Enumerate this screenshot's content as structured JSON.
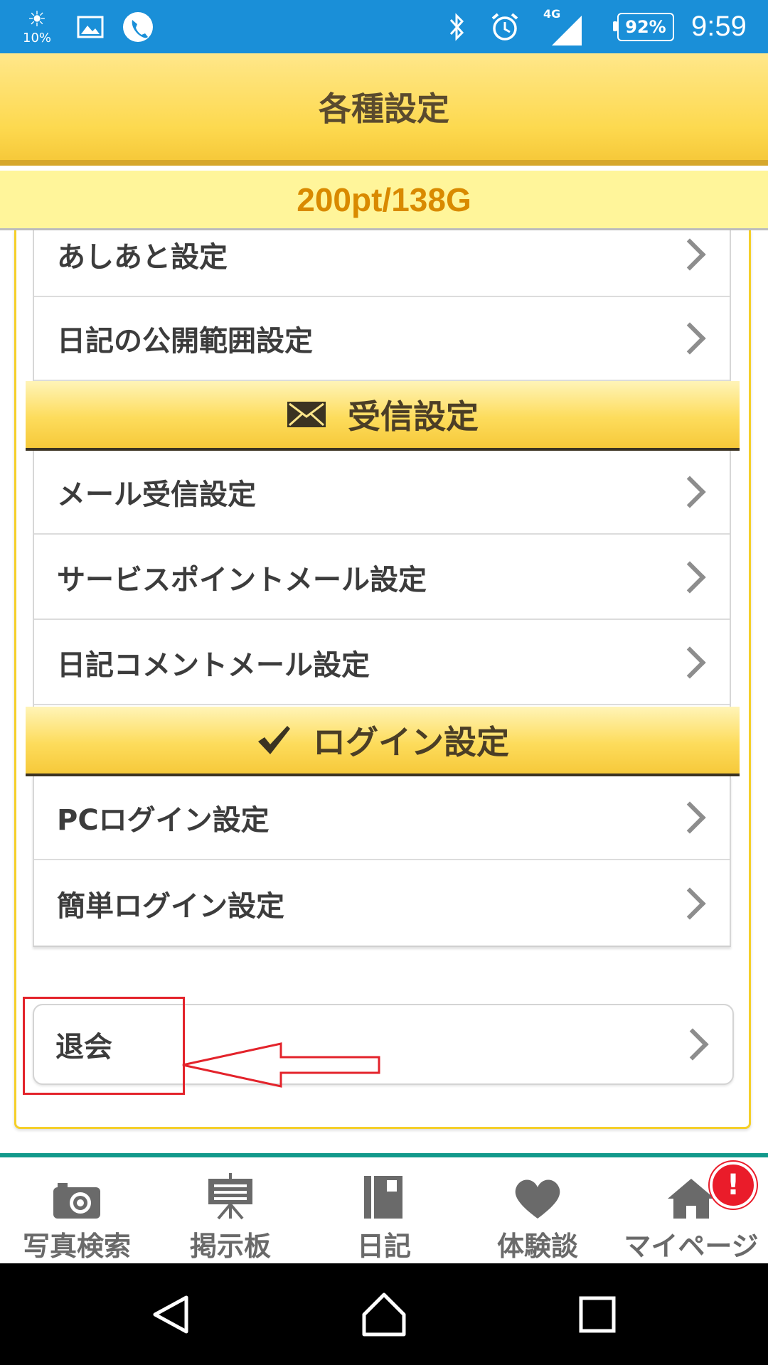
{
  "status_bar": {
    "brightness_percent": "10%",
    "network": "4G",
    "battery": "92%",
    "time": "9:59"
  },
  "header": {
    "title": "各種設定"
  },
  "points": {
    "text": "200pt/138G"
  },
  "top_items": [
    {
      "label": "あしあと設定"
    },
    {
      "label": "日記の公開範囲設定"
    }
  ],
  "sections": [
    {
      "title": "受信設定",
      "icon": "envelope-icon",
      "items": [
        {
          "label": "メール受信設定"
        },
        {
          "label": "サービスポイントメール設定"
        },
        {
          "label": "日記コメントメール設定"
        }
      ]
    },
    {
      "title": "ログイン設定",
      "icon": "checkmark-icon",
      "items": [
        {
          "label": "PCログイン設定"
        },
        {
          "label": "簡単ログイン設定"
        }
      ]
    }
  ],
  "withdraw": {
    "label": "退会"
  },
  "bottom_nav": [
    {
      "label": "写真検索",
      "icon": "camera-icon"
    },
    {
      "label": "掲示板",
      "icon": "board-icon"
    },
    {
      "label": "日記",
      "icon": "diary-icon"
    },
    {
      "label": "体験談",
      "icon": "heart-icon"
    },
    {
      "label": "マイページ",
      "icon": "home-icon"
    }
  ],
  "notification_badge": "!",
  "colors": {
    "status_bar": "#1a8fd8",
    "header": "#fdd94f",
    "points_text": "#d98a00",
    "nav_accent": "#12998b",
    "annotation": "#e3232b"
  }
}
